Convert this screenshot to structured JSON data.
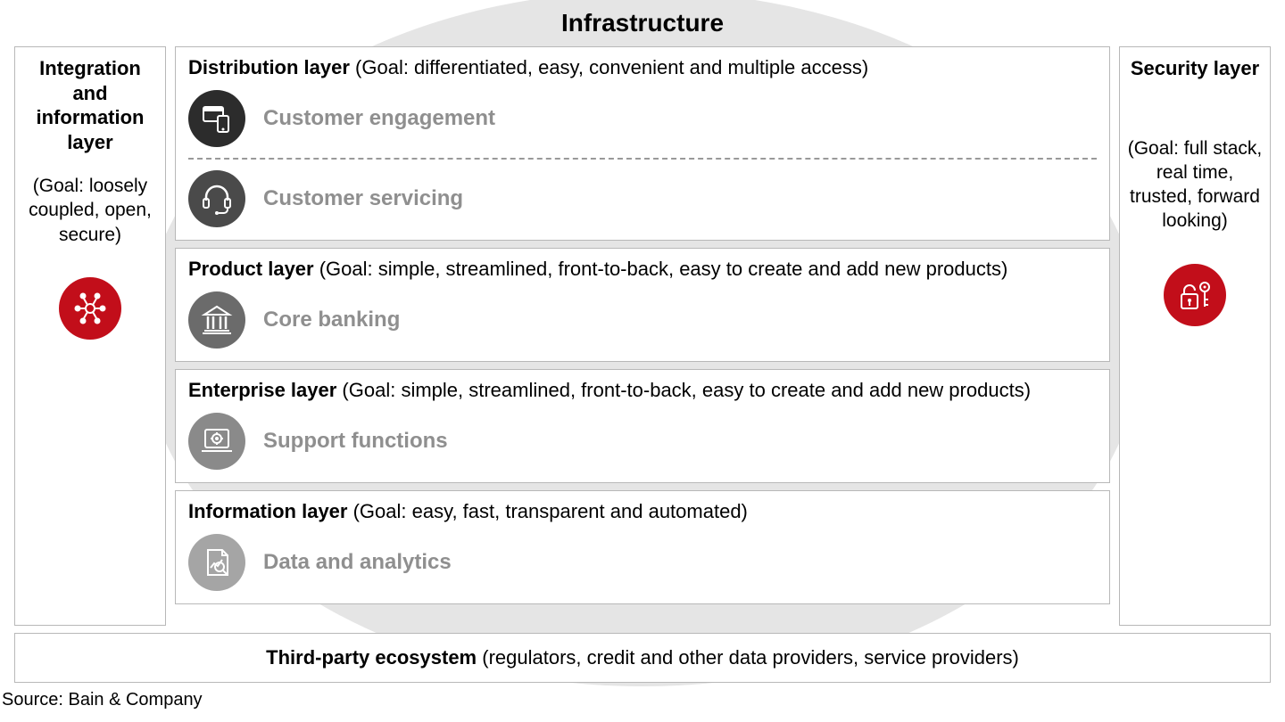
{
  "title": "Infrastructure",
  "left": {
    "heading": "Integration and information layer",
    "goal": "(Goal: loosely coupled, open, secure)",
    "icon": "network-icon"
  },
  "right": {
    "heading": "Security layer",
    "goal": "(Goal: full stack, real time, trusted, forward looking)",
    "icon": "lock-key-icon"
  },
  "center": {
    "distribution": {
      "title_bold": "Distribution layer",
      "title_rest": " (Goal: differentiated, easy, convenient and multiple access)",
      "rows": [
        {
          "label": "Customer engagement",
          "icon": "devices-icon"
        },
        {
          "label": "Customer servicing",
          "icon": "headset-icon"
        }
      ]
    },
    "product": {
      "title_bold": "Product layer",
      "title_rest": " (Goal: simple, streamlined, front-to-back, easy to create and add new products)",
      "row": {
        "label": "Core banking",
        "icon": "bank-icon"
      }
    },
    "enterprise": {
      "title_bold": "Enterprise layer",
      "title_rest": " (Goal: simple, streamlined, front-to-back, easy to create and add new products)",
      "row": {
        "label": "Support functions",
        "icon": "gear-laptop-icon"
      }
    },
    "information": {
      "title_bold": "Information layer",
      "title_rest": " (Goal: easy, fast, transparent and automated)",
      "row": {
        "label": "Data and analytics",
        "icon": "analytics-icon"
      }
    }
  },
  "bottom": {
    "title_bold": "Third-party ecosystem",
    "title_rest": " (regulators, credit and other data providers, service providers)"
  },
  "source": "Source: Bain & Company",
  "colors": {
    "accent": "#c20e1a"
  }
}
